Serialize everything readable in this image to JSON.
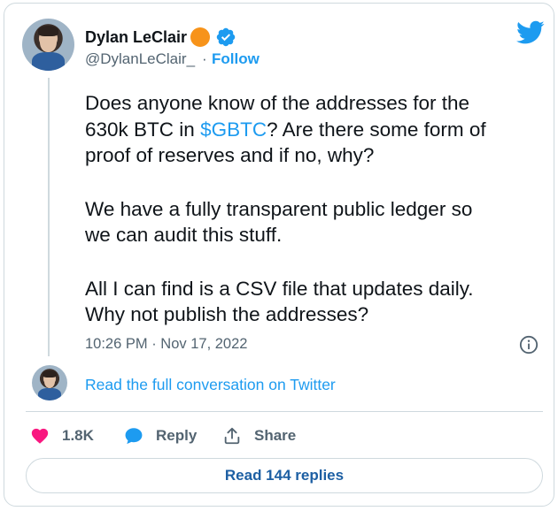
{
  "author": {
    "name": "Dylan LeClair",
    "handle": "@DylanLeClair_",
    "separator": "·",
    "follow_label": "Follow"
  },
  "tweet": {
    "paragraphs": [
      {
        "lines": [
          {
            "parts": [
              {
                "text": "Does anyone know of the addresses for the"
              }
            ]
          },
          {
            "parts": [
              {
                "text": "630k BTC in "
              },
              {
                "text": "$GBTC",
                "link": true
              },
              {
                "text": "? Are there some form of"
              }
            ]
          },
          {
            "parts": [
              {
                "text": "proof of reserves and if no, why?"
              }
            ]
          }
        ]
      },
      {
        "lines": [
          {
            "parts": [
              {
                "text": "We have a fully transparent public ledger so"
              }
            ]
          },
          {
            "parts": [
              {
                "text": "we can audit this stuff."
              }
            ]
          }
        ]
      },
      {
        "lines": [
          {
            "parts": [
              {
                "text": "All I can find is a CSV file that updates daily."
              }
            ]
          },
          {
            "parts": [
              {
                "text": "Why not publish the addresses?"
              }
            ]
          }
        ]
      }
    ],
    "timestamp": "10:26 PM · Nov 17, 2022"
  },
  "conversation_link": "Read the full conversation on Twitter",
  "actions": {
    "like_count": "1.8K",
    "reply_label": "Reply",
    "share_label": "Share"
  },
  "read_replies_label": "Read 144 replies",
  "icons": {
    "brand": "twitter-bird-icon",
    "verified": "verified-badge-icon",
    "info": "info-icon",
    "like": "heart-icon",
    "reply": "speech-bubble-icon",
    "share": "share-upload-icon"
  },
  "colors": {
    "accent": "#1d9bf0",
    "like": "#f91880",
    "bitcoin_badge": "#f7931a",
    "secondary_text": "#536471",
    "border": "#cfd9de"
  }
}
